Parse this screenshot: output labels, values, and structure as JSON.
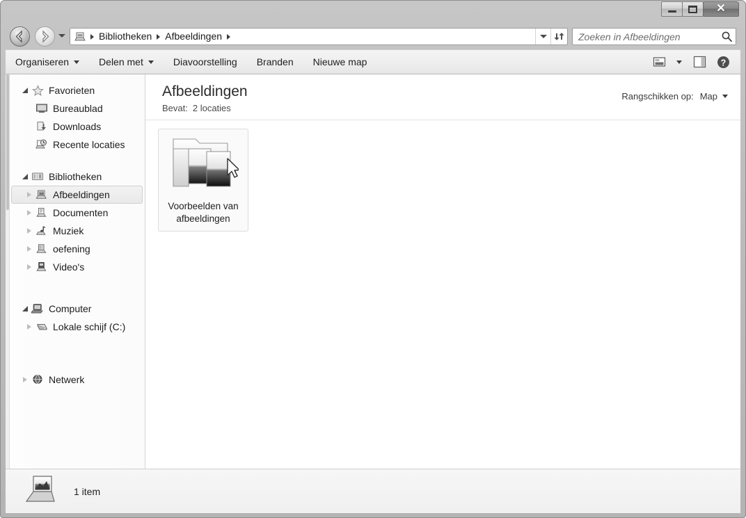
{
  "window": {
    "controls": {
      "minimize_label": "Minimaliseren",
      "maximize_label": "Maximaliseren",
      "close_label": "✕"
    }
  },
  "address_bar": {
    "back_label": "Terug",
    "forward_label": "Vooruit",
    "recent_dropdown_label": "Recente locaties",
    "root_icon": "library-icon",
    "crumbs": [
      "Bibliotheken",
      "Afbeeldingen"
    ],
    "separator": "▸",
    "dropdown_icon": "chevron-down-icon",
    "refresh_icon": "refresh-icon"
  },
  "search": {
    "placeholder": "Zoeken in Afbeeldingen",
    "value": "",
    "icon": "search-icon"
  },
  "toolbar": {
    "items": [
      {
        "label": "Organiseren",
        "has_caret": true
      },
      {
        "label": "Delen met",
        "has_caret": true
      },
      {
        "label": "Diavoorstelling",
        "has_caret": false
      },
      {
        "label": "Branden",
        "has_caret": false
      },
      {
        "label": "Nieuwe map",
        "has_caret": false
      }
    ],
    "change_view_icon": "change-view-icon",
    "change_view_caret": "chevron-down-icon",
    "preview_pane_icon": "preview-pane-icon",
    "help_icon": "help-icon"
  },
  "sidebar": {
    "groups": [
      {
        "header": {
          "label": "Favorieten",
          "icon": "star-icon",
          "expanded": true
        },
        "items": [
          {
            "label": "Bureaublad",
            "icon": "desktop-icon",
            "expander": "none"
          },
          {
            "label": "Downloads",
            "icon": "downloads-icon",
            "expander": "none"
          },
          {
            "label": "Recente locaties",
            "icon": "recent-locations-icon",
            "expander": "none"
          }
        ]
      },
      {
        "header": {
          "label": "Bibliotheken",
          "icon": "libraries-icon",
          "expanded": true
        },
        "items": [
          {
            "label": "Afbeeldingen",
            "icon": "pictures-library-icon",
            "expander": "closed",
            "selected": true
          },
          {
            "label": "Documenten",
            "icon": "documents-library-icon",
            "expander": "closed",
            "selected": false
          },
          {
            "label": "Muziek",
            "icon": "music-library-icon",
            "expander": "closed",
            "selected": false
          },
          {
            "label": "oefening",
            "icon": "library-icon",
            "expander": "closed",
            "selected": false
          },
          {
            "label": "Video's",
            "icon": "videos-library-icon",
            "expander": "closed",
            "selected": false
          }
        ]
      },
      {
        "header": {
          "label": "Computer",
          "icon": "computer-icon",
          "expanded": true
        },
        "items": [
          {
            "label": "Lokale schijf (C:)",
            "icon": "hard-drive-icon",
            "expander": "closed"
          }
        ]
      },
      {
        "header": {
          "label": "Netwerk",
          "icon": "network-icon",
          "expanded": false,
          "expander": "closed"
        },
        "items": []
      }
    ]
  },
  "content": {
    "title": "Afbeeldingen",
    "subtitle_label": "Bevat:",
    "subtitle_value": "2 locaties",
    "arrange_label": "Rangschikken op:",
    "arrange_value": "Map",
    "arrange_caret": "chevron-down-icon",
    "items": [
      {
        "label_line1": "Voorbeelden van",
        "label_line2": "afbeeldingen",
        "icon": "pictures-folder-icon"
      }
    ]
  },
  "status_bar": {
    "icon": "library-icon",
    "text": "1 item"
  },
  "colors": {
    "frame": "#bcbcbc",
    "toolbar": "#eeeeee",
    "content_bg": "#ffffff",
    "selection": "#e9e9e9",
    "text": "#1c1c1c"
  }
}
